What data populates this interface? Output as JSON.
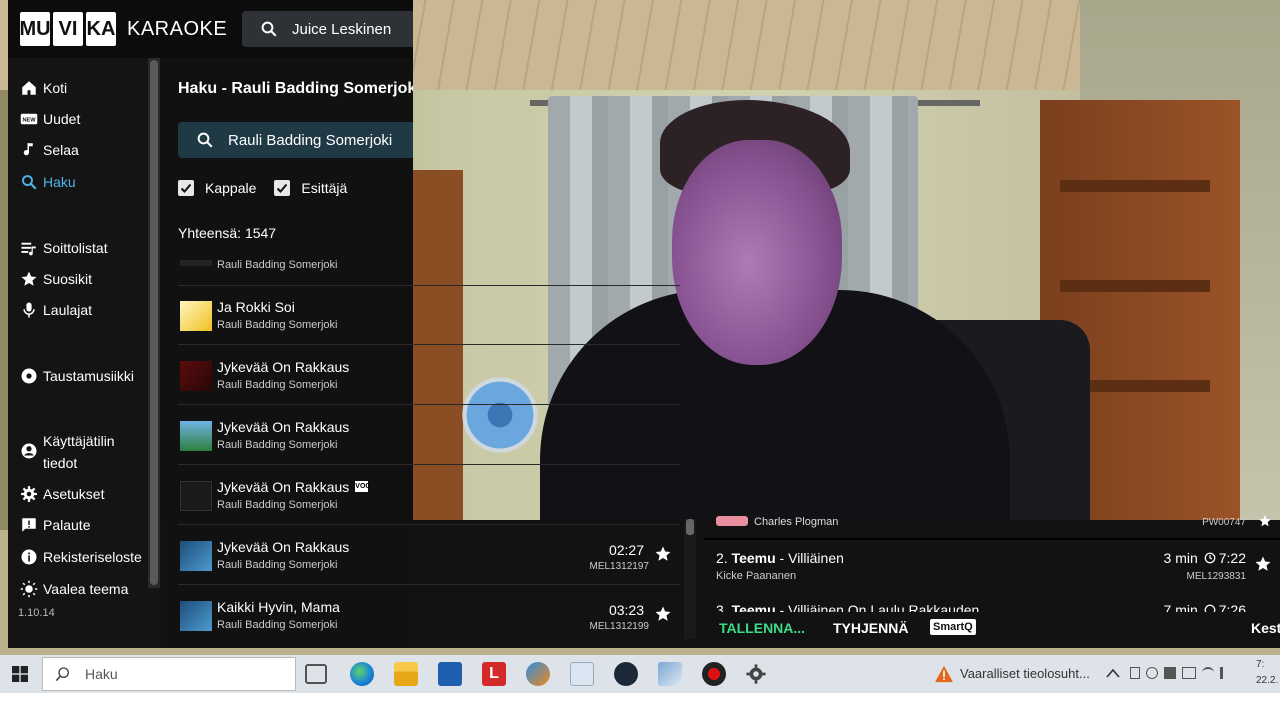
{
  "app": {
    "logo_letters": [
      "MU",
      "VI",
      "KA"
    ],
    "logo_word": "KARAOKE",
    "top_search_value": "Juice Leskinen"
  },
  "sidebar": {
    "items": [
      {
        "label": "Koti",
        "icon": "home-icon"
      },
      {
        "label": "Uudet",
        "icon": "new-badge-icon"
      },
      {
        "label": "Selaa",
        "icon": "music-note-icon"
      },
      {
        "label": "Haku",
        "icon": "search-icon",
        "active": true
      },
      {
        "label": "Soittolistat",
        "icon": "playlist-icon"
      },
      {
        "label": "Suosikit",
        "icon": "star-icon"
      },
      {
        "label": "Laulajat",
        "icon": "microphone-icon"
      },
      {
        "label": "Taustamusiikki",
        "icon": "record-icon"
      },
      {
        "label": "Käyttäjätilin",
        "label2": "tiedot",
        "icon": "account-icon"
      },
      {
        "label": "Asetukset",
        "icon": "gear-icon"
      },
      {
        "label": "Palaute",
        "icon": "feedback-icon"
      },
      {
        "label": "Rekisteriseloste",
        "icon": "info-icon"
      },
      {
        "label": "Vaalea teema",
        "icon": "sun-icon"
      }
    ],
    "version": "1.10.14"
  },
  "search": {
    "title": "Haku - Rauli Badding Somerjoki",
    "value": "Rauli Badding Somerjoki",
    "filters": [
      {
        "label": "Kappale",
        "checked": true
      },
      {
        "label": "Esittäjä",
        "checked": true
      }
    ],
    "total": "Yhteensä: 1547"
  },
  "results": [
    {
      "title": "",
      "artist": "Rauli Badding Somerjoki",
      "duration": "",
      "code": ""
    },
    {
      "title": "Ja Rokki Soi",
      "artist": "Rauli Badding Somerjoki",
      "duration": "",
      "code": ""
    },
    {
      "title": "Jykevää On Rakkaus",
      "artist": "Rauli Badding Somerjoki",
      "duration": "",
      "code": ""
    },
    {
      "title": "Jykevää On Rakkaus",
      "artist": "Rauli Badding Somerjoki",
      "duration": "",
      "code": ""
    },
    {
      "title": "Jykevää On Rakkaus",
      "artist": "Rauli Badding Somerjoki",
      "duration": "",
      "code": "",
      "voc": "VOC"
    },
    {
      "title": "Jykevää On Rakkaus",
      "artist": "Rauli Badding Somerjoki",
      "duration": "02:27",
      "code": "MEL1312197"
    },
    {
      "title": "Kaikki Hyvin, Mama",
      "artist": "Rauli Badding Somerjoki",
      "duration": "03:23",
      "code": "MEL1312199"
    }
  ],
  "queue": {
    "row1": {
      "singer": "Charles Plogman",
      "code": "PW00747"
    },
    "row2": {
      "index": "2.",
      "name": "Teemu",
      "song": " - Villiäinen",
      "artist": "Kicke Paananen",
      "wait": "3 min",
      "time": "7:22",
      "code": "MEL1293831"
    },
    "row3": {
      "index": "3.",
      "name": "Teemu",
      "song": " - Villiäinen On Laulu Rakkauden",
      "wait": "7 min",
      "time": "7:26"
    },
    "actions": {
      "save": "TALLENNA...",
      "clear": "TYHJENNÄ",
      "smartq": "SmartQ",
      "right": "Kest"
    }
  },
  "taskbar": {
    "search_placeholder": "Haku",
    "warning_text": "Vaaralliset tieolosuht...",
    "clock_time": "7:",
    "clock_date": "22.2."
  },
  "colors": {
    "accent": "#4fb3e8",
    "save": "#3ddc84",
    "search_bg": "#1f3a45"
  }
}
